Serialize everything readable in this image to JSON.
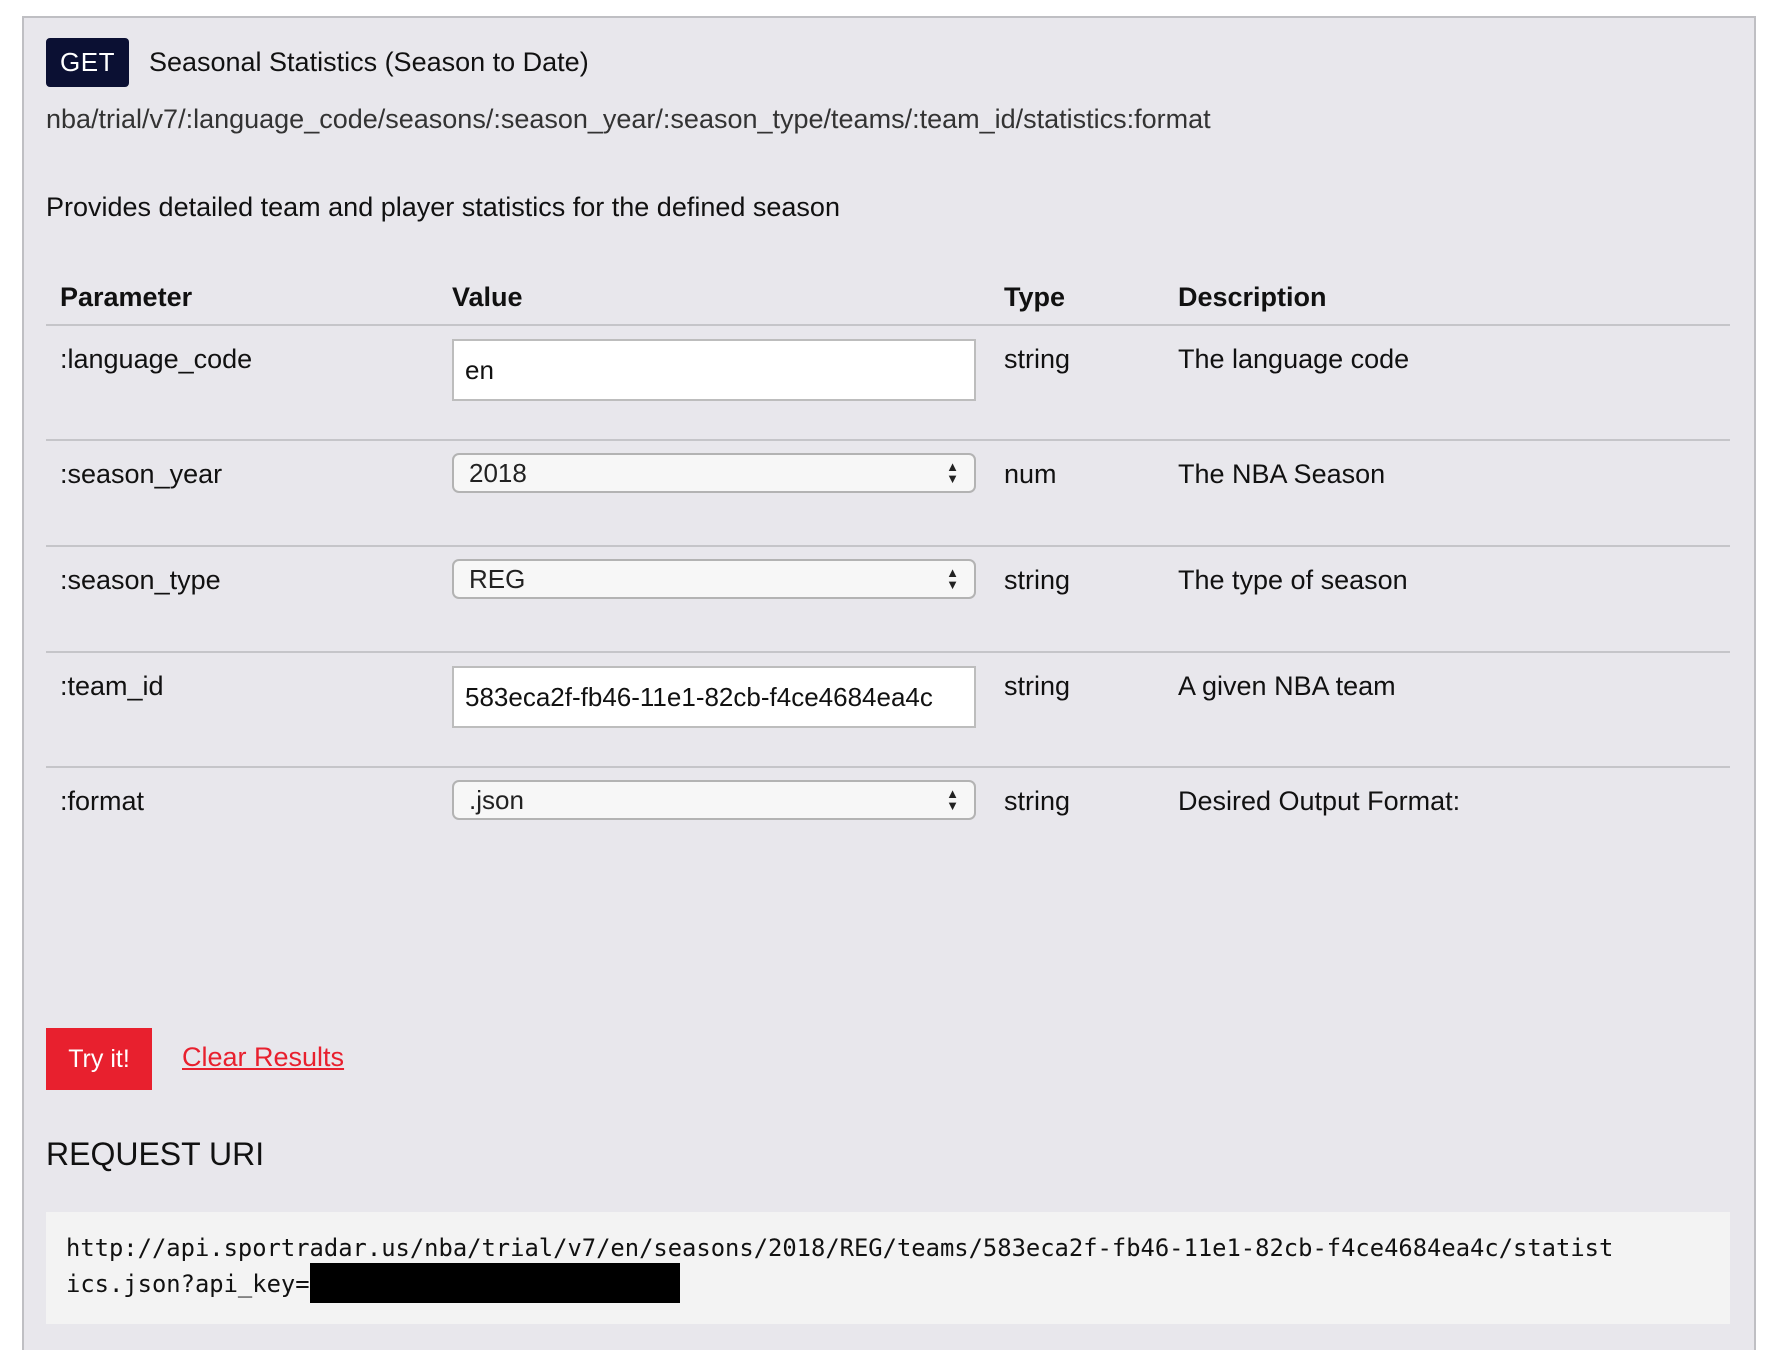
{
  "endpoint": {
    "method": "GET",
    "title": "Seasonal Statistics (Season to Date)",
    "path": "nba/trial/v7/:language_code/seasons/:season_year/:season_type/teams/:team_id/statistics:format",
    "description": "Provides detailed team and player statistics for the defined season"
  },
  "table": {
    "headers": {
      "parameter": "Parameter",
      "value": "Value",
      "type": "Type",
      "description": "Description"
    },
    "rows": [
      {
        "name": ":language_code",
        "control": "text",
        "value": "en",
        "type": "string",
        "description": "The language code"
      },
      {
        "name": ":season_year",
        "control": "select",
        "value": "2018",
        "type": "num",
        "description": "The NBA Season"
      },
      {
        "name": ":season_type",
        "control": "select",
        "value": "REG",
        "type": "string",
        "description": "The type of season"
      },
      {
        "name": ":team_id",
        "control": "text",
        "value": "583eca2f-fb46-11e1-82cb-f4ce4684ea4c",
        "type": "string",
        "description": "A given NBA team"
      },
      {
        "name": ":format",
        "control": "select",
        "value": ".json",
        "type": "string",
        "description": "Desired Output Format:"
      }
    ]
  },
  "actions": {
    "try_label": "Try it!",
    "clear_label": "Clear Results"
  },
  "request": {
    "heading": "REQUEST URI",
    "uri_line1": "http://api.sportradar.us/nba/trial/v7/en/seasons/2018/REG/teams/583eca2f-fb46-11e1-82cb-f4ce4684ea4c/statist",
    "uri_line2": "ics.json?api_key="
  },
  "colors": {
    "panel_bg": "#e8e7ec",
    "method_badge": "#0b1033",
    "accent": "#e8202e"
  }
}
